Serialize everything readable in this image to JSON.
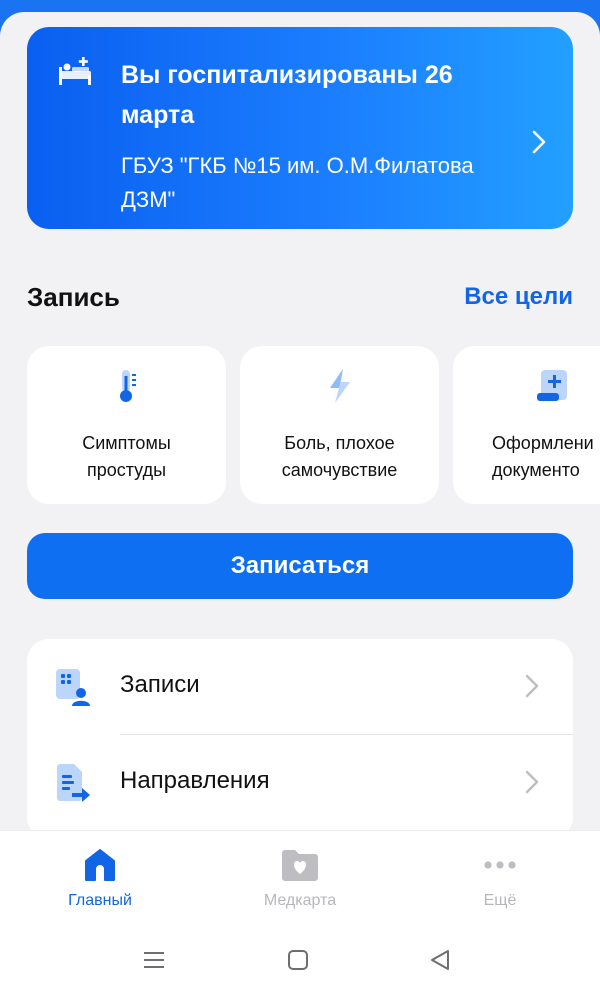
{
  "hospitalization": {
    "title": "Вы госпитализированы 26 марта",
    "clinic": "ГБУЗ \"ГКБ №15 им. О.М.Филатова ДЗМ\"",
    "icon": "hospital-bed-icon"
  },
  "booking": {
    "section_title": "Запись",
    "all_link": "Все цели",
    "tiles": [
      {
        "label": "Симптомы\nпростуды",
        "icon": "thermometer-icon"
      },
      {
        "label": "Боль, плохое\nсамочувствие",
        "icon": "lightning-icon"
      },
      {
        "label": "Оформлени\nдокументо",
        "icon": "document-add-icon"
      }
    ],
    "book_button": "Записаться"
  },
  "menu": [
    {
      "label": "Записи",
      "icon": "appointments-icon"
    },
    {
      "label": "Направления",
      "icon": "referrals-icon"
    }
  ],
  "tabbar": {
    "tabs": [
      {
        "label": "Главный",
        "icon": "home-icon",
        "active": true
      },
      {
        "label": "Медкарта",
        "icon": "medcard-folder-icon",
        "active": false
      },
      {
        "label": "Ещё",
        "icon": "more-dots-icon",
        "active": false
      }
    ]
  },
  "colors": {
    "accent": "#0f6ff3",
    "link": "#1266e6",
    "background": "#f2f2f4",
    "inactive": "#b6b6bb"
  }
}
